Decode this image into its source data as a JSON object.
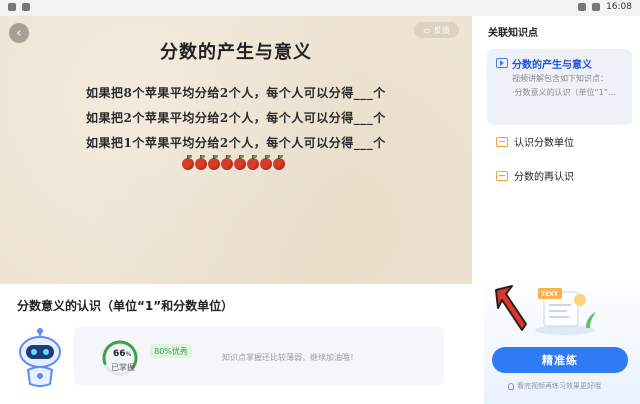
{
  "status_bar": {
    "time": "16:08"
  },
  "video": {
    "title": "分数的产生与意义",
    "feedback_label": "反馈",
    "lines": [
      "如果把8个苹果平均分给2个人，每个人可以分得___个",
      "如果把2个苹果平均分给2个人，每个人可以分得___个",
      "如果把1个苹果平均分给2个人，每个人可以分得___个"
    ],
    "apple_count": 8
  },
  "sidebar": {
    "title": "关联知识点",
    "active": {
      "name": "分数的产生与意义",
      "desc1": "视频讲解包含如下知识点：",
      "desc2": "·分数意义的认识（单位“1”..."
    },
    "items": [
      {
        "label": "认识分数单位",
        "icon": "card-icon"
      },
      {
        "label": "分数的再认识",
        "icon": "card-icon"
      }
    ],
    "practice_button": "精准练",
    "hint": "看完视频再练习效果更好哦"
  },
  "lesson": {
    "title": "分数意义的认识（单位“1”和分数单位）",
    "mastery_percent": 66,
    "mastery_value": "66",
    "mastery_unit": "%",
    "mastery_label": "已掌握",
    "badge": "80%优秀",
    "comment": "知识点掌握还比较薄弱，继续加油哦！"
  },
  "colors": {
    "accent": "#2f7bf6",
    "success": "#3aa24a",
    "warning": "#f0a030"
  }
}
